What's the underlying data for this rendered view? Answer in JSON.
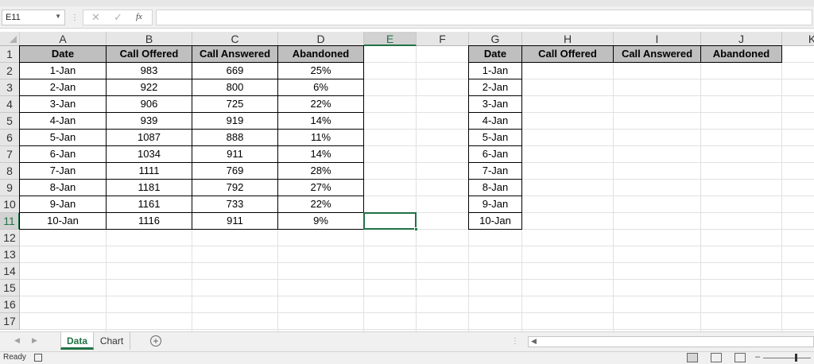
{
  "formula_bar": {
    "name_box": "E11",
    "cancel_icon": "x-icon",
    "enter_icon": "check-icon",
    "function_label": "fx",
    "formula": ""
  },
  "columns": [
    "A",
    "B",
    "C",
    "D",
    "E",
    "F",
    "G",
    "H",
    "I",
    "J",
    "K"
  ],
  "rows": [
    "1",
    "2",
    "3",
    "4",
    "5",
    "6",
    "7",
    "8",
    "9",
    "10",
    "11",
    "12",
    "13",
    "14",
    "15",
    "16",
    "17"
  ],
  "selected_cell": "E11",
  "table1": {
    "headers": [
      "Date",
      "Call Offered",
      "Call Answered",
      "Abandoned"
    ],
    "rows": [
      [
        "1-Jan",
        "983",
        "669",
        "25%"
      ],
      [
        "2-Jan",
        "922",
        "800",
        "6%"
      ],
      [
        "3-Jan",
        "906",
        "725",
        "22%"
      ],
      [
        "4-Jan",
        "939",
        "919",
        "14%"
      ],
      [
        "5-Jan",
        "1087",
        "888",
        "11%"
      ],
      [
        "6-Jan",
        "1034",
        "911",
        "14%"
      ],
      [
        "7-Jan",
        "1111",
        "769",
        "28%"
      ],
      [
        "8-Jan",
        "1181",
        "792",
        "27%"
      ],
      [
        "9-Jan",
        "1161",
        "733",
        "22%"
      ],
      [
        "10-Jan",
        "1116",
        "911",
        "9%"
      ]
    ]
  },
  "table2": {
    "headers": [
      "Date",
      "Call Offered",
      "Call Answered",
      "Abandoned"
    ],
    "dates": [
      "1-Jan",
      "2-Jan",
      "3-Jan",
      "4-Jan",
      "5-Jan",
      "6-Jan",
      "7-Jan",
      "8-Jan",
      "9-Jan",
      "10-Jan"
    ]
  },
  "sheet_tabs": {
    "tabs": [
      "Data",
      "Chart"
    ],
    "active": "Data",
    "add_icon": "plus-circle-icon"
  },
  "status_bar": {
    "status": "Ready"
  },
  "colors": {
    "accent": "#217346",
    "header_fill": "#bfbfbf"
  }
}
